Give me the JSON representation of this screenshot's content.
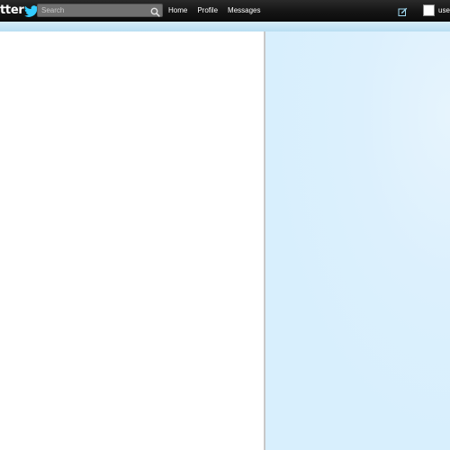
{
  "header": {
    "logo_text": "tter",
    "search": {
      "placeholder": "Search",
      "value": ""
    },
    "nav": [
      "Home",
      "Profile",
      "Messages"
    ],
    "username": "user"
  },
  "icons": {
    "logo": "bird-icon",
    "search": "search-icon",
    "compose": "compose-icon"
  },
  "colors": {
    "topbar": "#151515",
    "accent": "#33ccff",
    "background": "#c0deed",
    "main": "#ffffff",
    "sidebar": "#ddeffd"
  }
}
